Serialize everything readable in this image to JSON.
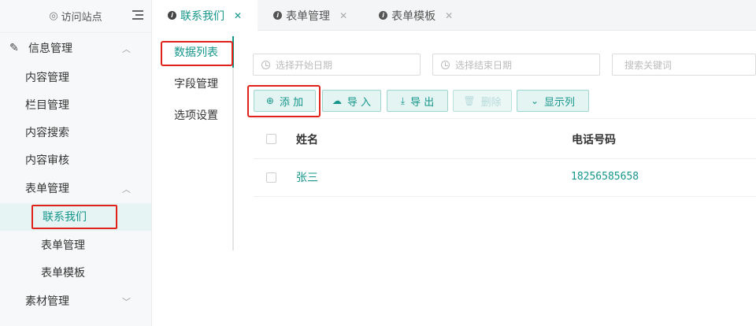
{
  "sidebar": {
    "visit_site": "访问站点",
    "groups": [
      {
        "label": "信息管理",
        "icon": "edit-icon",
        "expanded": true
      },
      {
        "label": "表单管理",
        "expanded": true
      },
      {
        "label": "素材管理",
        "expanded": false
      }
    ],
    "info_items": [
      "内容管理",
      "栏目管理",
      "内容搜索",
      "内容审核"
    ],
    "form_items": [
      "联系我们",
      "表单管理",
      "表单模板"
    ],
    "active_item": "联系我们"
  },
  "tabs": [
    {
      "label": "联系我们",
      "active": true
    },
    {
      "label": "表单管理",
      "active": false
    },
    {
      "label": "表单模板",
      "active": false
    }
  ],
  "subnav": [
    "数据列表",
    "字段管理",
    "选项设置"
  ],
  "filters": {
    "start_date_placeholder": "选择开始日期",
    "end_date_placeholder": "选择结束日期",
    "keyword_placeholder": "搜索关键词"
  },
  "toolbar": {
    "add": "添 加",
    "import": "导 入",
    "export": "导 出",
    "delete": "删除",
    "columns": "显示列"
  },
  "table": {
    "columns": [
      "姓名",
      "电话号码"
    ],
    "rows": [
      {
        "name": "张三",
        "phone": "18256585658"
      }
    ]
  },
  "colors": {
    "accent": "#16968b",
    "highlight": "#e0221b"
  }
}
